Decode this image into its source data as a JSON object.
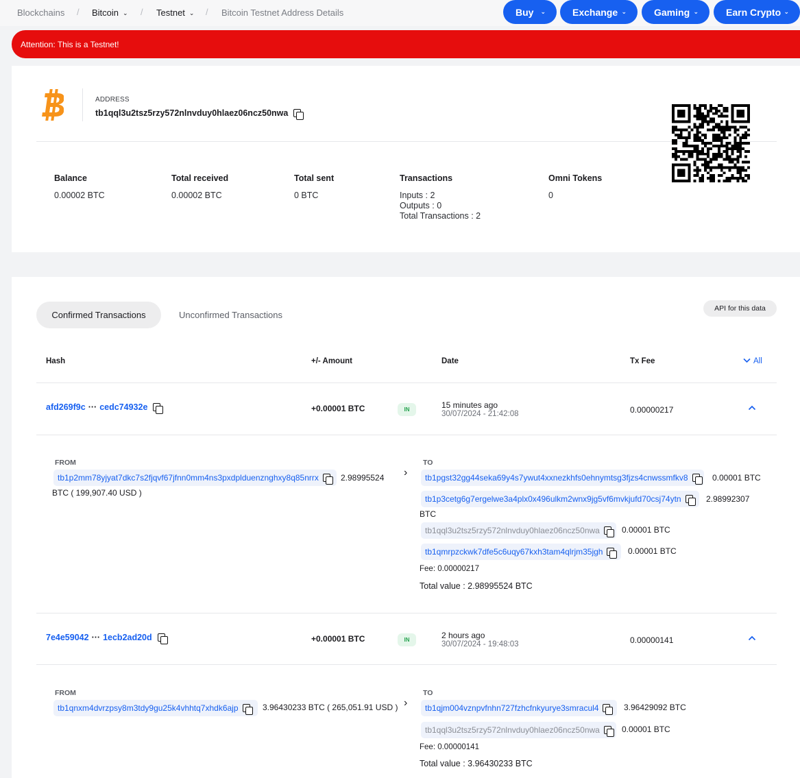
{
  "nav": {
    "breadcrumbs": [
      "Blockchains",
      "Bitcoin",
      "Testnet",
      "Bitcoin Testnet Address Details"
    ],
    "buttons": [
      "Buy",
      "Exchange",
      "Gaming",
      "Earn Crypto"
    ],
    "accent": "#1760f0"
  },
  "alert": {
    "text": "Attention: This is a Testnet!",
    "color": "#e60d0d"
  },
  "address": {
    "label": "ADDRESS",
    "value": "tb1qql3u2tsz5rzy572nlnvduy0hlaez06ncz50nwa",
    "stats": [
      {
        "title": "Balance",
        "value": "0.00002 BTC"
      },
      {
        "title": "Total received",
        "value": "0.00002 BTC"
      },
      {
        "title": "Total sent",
        "value": "0 BTC"
      },
      {
        "title": "Transactions",
        "lines": [
          "Inputs : 2",
          "Outputs : 0",
          "Total Transactions : 2"
        ]
      },
      {
        "title": "Omni Tokens",
        "value": "0"
      }
    ]
  },
  "tabs": {
    "active": "Confirmed Transactions",
    "other": "Unconfirmed Transactions",
    "api": "API for this data"
  },
  "table": {
    "headers": [
      "Hash",
      "+/- Amount",
      "Date",
      "Tx Fee",
      "All"
    ],
    "rows": [
      {
        "hash_start": "afd269f9c",
        "hash_dots": "···",
        "hash_end": "cedc74932e",
        "amount": "+0.00001 BTC",
        "badge": "IN",
        "date_rel": "15 minutes ago",
        "date_abs": "30/07/2024 - 21:42:08",
        "fee": "0.00000217",
        "from_label": "FROM",
        "from_addr": "tb1p2mm78yjyat7dkc7s2fjqvf67jfnn0mm4ns3pxdplduenznghxy8q85nrrx",
        "from_amt": "2.98995524",
        "from_amt2": "BTC ( 199,907.40 USD )",
        "to_label": "TO",
        "to": [
          {
            "addr": "tb1pgst32gg44seka69y4s7ywut4xxnezkhfs0ehnymtsg3fjzs4cnwssmfkv8",
            "amt": "0.00001 BTC"
          },
          {
            "addr": "tb1p3cetg6g7ergelwe3a4plx0x496ulkm2wnx9jg5vf6mvkjufd70csj74ytn",
            "amt": "2.98992307",
            "amt2": "BTC"
          },
          {
            "addr": "tb1qql3u2tsz5rzy572nlnvduy0hlaez06ncz50nwa",
            "amt": "0.00001 BTC"
          },
          {
            "addr": "tb1qmrpzckwk7dfe5c6uqy67kxh3tam4qlrjm35jgh",
            "amt": "0.00001 BTC"
          }
        ],
        "fee_line": "Fee: 0.00000217",
        "total_line": "Total value : 2.98995524 BTC"
      },
      {
        "hash_start": "7e4e59042",
        "hash_dots": "···",
        "hash_end": "1ecb2ad20d",
        "amount": "+0.00001 BTC",
        "badge": "IN",
        "date_rel": "2 hours ago",
        "date_abs": "30/07/2024 - 19:48:03",
        "fee": "0.00000141",
        "from_label": "FROM",
        "from_addr": "tb1qnxm4dvrzpsy8m3tdy9gu25k4vhhtq7xhdk6ajp",
        "from_amt": "3.96430233 BTC ( 265,051.91 USD )",
        "to_label": "TO",
        "to": [
          {
            "addr": "tb1qjm004vznpvfnhn727fzhcfnkyurye3smracul4",
            "amt": "3.96429092 BTC"
          },
          {
            "addr": "tb1qql3u2tsz5rzy572nlnvduy0hlaez06ncz50nwa",
            "amt": "0.00001 BTC"
          }
        ],
        "fee_line": "Fee: 0.00000141",
        "total_line": "Total value : 3.96430233 BTC"
      }
    ]
  }
}
